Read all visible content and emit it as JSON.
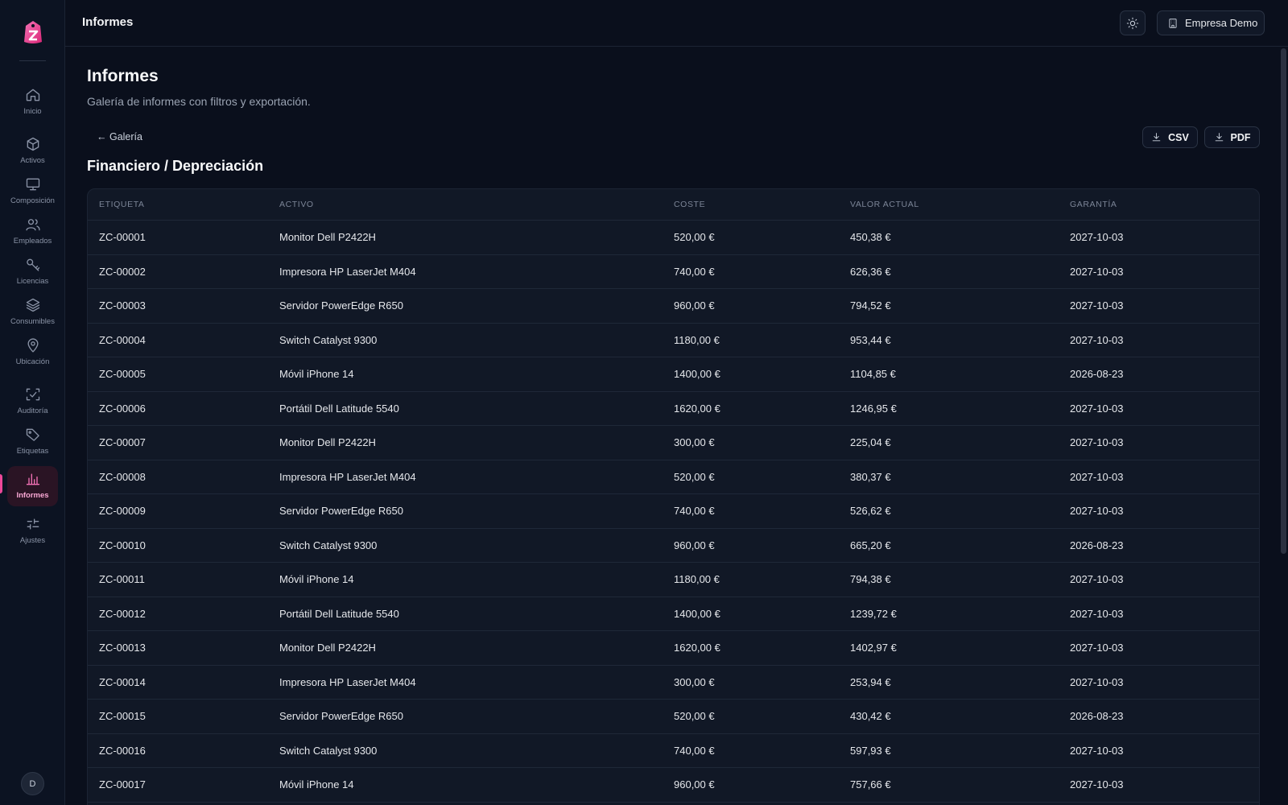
{
  "sidebar": {
    "items": [
      {
        "label": "Inicio",
        "icon": "home-icon"
      },
      {
        "label": "Activos",
        "icon": "box-icon"
      },
      {
        "label": "Composición",
        "icon": "monitor-icon"
      },
      {
        "label": "Empleados",
        "icon": "users-icon"
      },
      {
        "label": "Licencias",
        "icon": "key-icon"
      },
      {
        "label": "Consumibles",
        "icon": "layers-icon"
      },
      {
        "label": "Ubicación",
        "icon": "map-pin-icon"
      },
      {
        "label": "Auditoría",
        "icon": "scan-check-icon"
      },
      {
        "label": "Etiquetas",
        "icon": "tag-icon"
      },
      {
        "label": "Informes",
        "icon": "bar-chart-icon"
      },
      {
        "label": "Ajustes",
        "icon": "sliders-icon"
      }
    ],
    "active": "Informes",
    "avatar_initial": "D",
    "accent": "#ec4899"
  },
  "header": {
    "title": "Informes",
    "company": "Empresa Demo"
  },
  "main": {
    "title": "Informes",
    "subtitle": "Galería de informes con filtros y exportación.",
    "back_label": "← Galería",
    "csv_label": "CSV",
    "pdf_label": "PDF",
    "section_title": "Financiero / Depreciación"
  },
  "table": {
    "columns": [
      "ETIQUETA",
      "ACTIVO",
      "COSTE",
      "VALOR ACTUAL",
      "GARANTÍA"
    ],
    "rows": [
      [
        "ZC-00001",
        "Monitor Dell P2422H",
        "520,00 €",
        "450,38 €",
        "2027-10-03"
      ],
      [
        "ZC-00002",
        "Impresora HP LaserJet M404",
        "740,00 €",
        "626,36 €",
        "2027-10-03"
      ],
      [
        "ZC-00003",
        "Servidor PowerEdge R650",
        "960,00 €",
        "794,52 €",
        "2027-10-03"
      ],
      [
        "ZC-00004",
        "Switch Catalyst 9300",
        "1180,00 €",
        "953,44 €",
        "2027-10-03"
      ],
      [
        "ZC-00005",
        "Móvil iPhone 14",
        "1400,00 €",
        "1104,85 €",
        "2026-08-23"
      ],
      [
        "ZC-00006",
        "Portátil Dell Latitude 5540",
        "1620,00 €",
        "1246,95 €",
        "2027-10-03"
      ],
      [
        "ZC-00007",
        "Monitor Dell P2422H",
        "300,00 €",
        "225,04 €",
        "2027-10-03"
      ],
      [
        "ZC-00008",
        "Impresora HP LaserJet M404",
        "520,00 €",
        "380,37 €",
        "2027-10-03"
      ],
      [
        "ZC-00009",
        "Servidor PowerEdge R650",
        "740,00 €",
        "526,62 €",
        "2027-10-03"
      ],
      [
        "ZC-00010",
        "Switch Catalyst 9300",
        "960,00 €",
        "665,20 €",
        "2026-08-23"
      ],
      [
        "ZC-00011",
        "Móvil iPhone 14",
        "1180,00 €",
        "794,38 €",
        "2027-10-03"
      ],
      [
        "ZC-00012",
        "Portátil Dell Latitude 5540",
        "1400,00 €",
        "1239,72 €",
        "2027-10-03"
      ],
      [
        "ZC-00013",
        "Monitor Dell P2422H",
        "1620,00 €",
        "1402,97 €",
        "2027-10-03"
      ],
      [
        "ZC-00014",
        "Impresora HP LaserJet M404",
        "300,00 €",
        "253,94 €",
        "2027-10-03"
      ],
      [
        "ZC-00015",
        "Servidor PowerEdge R650",
        "520,00 €",
        "430,42 €",
        "2026-08-23"
      ],
      [
        "ZC-00016",
        "Switch Catalyst 9300",
        "740,00 €",
        "597,93 €",
        "2027-10-03"
      ],
      [
        "ZC-00017",
        "Móvil iPhone 14",
        "960,00 €",
        "757,66 €",
        "2027-10-03"
      ]
    ]
  }
}
